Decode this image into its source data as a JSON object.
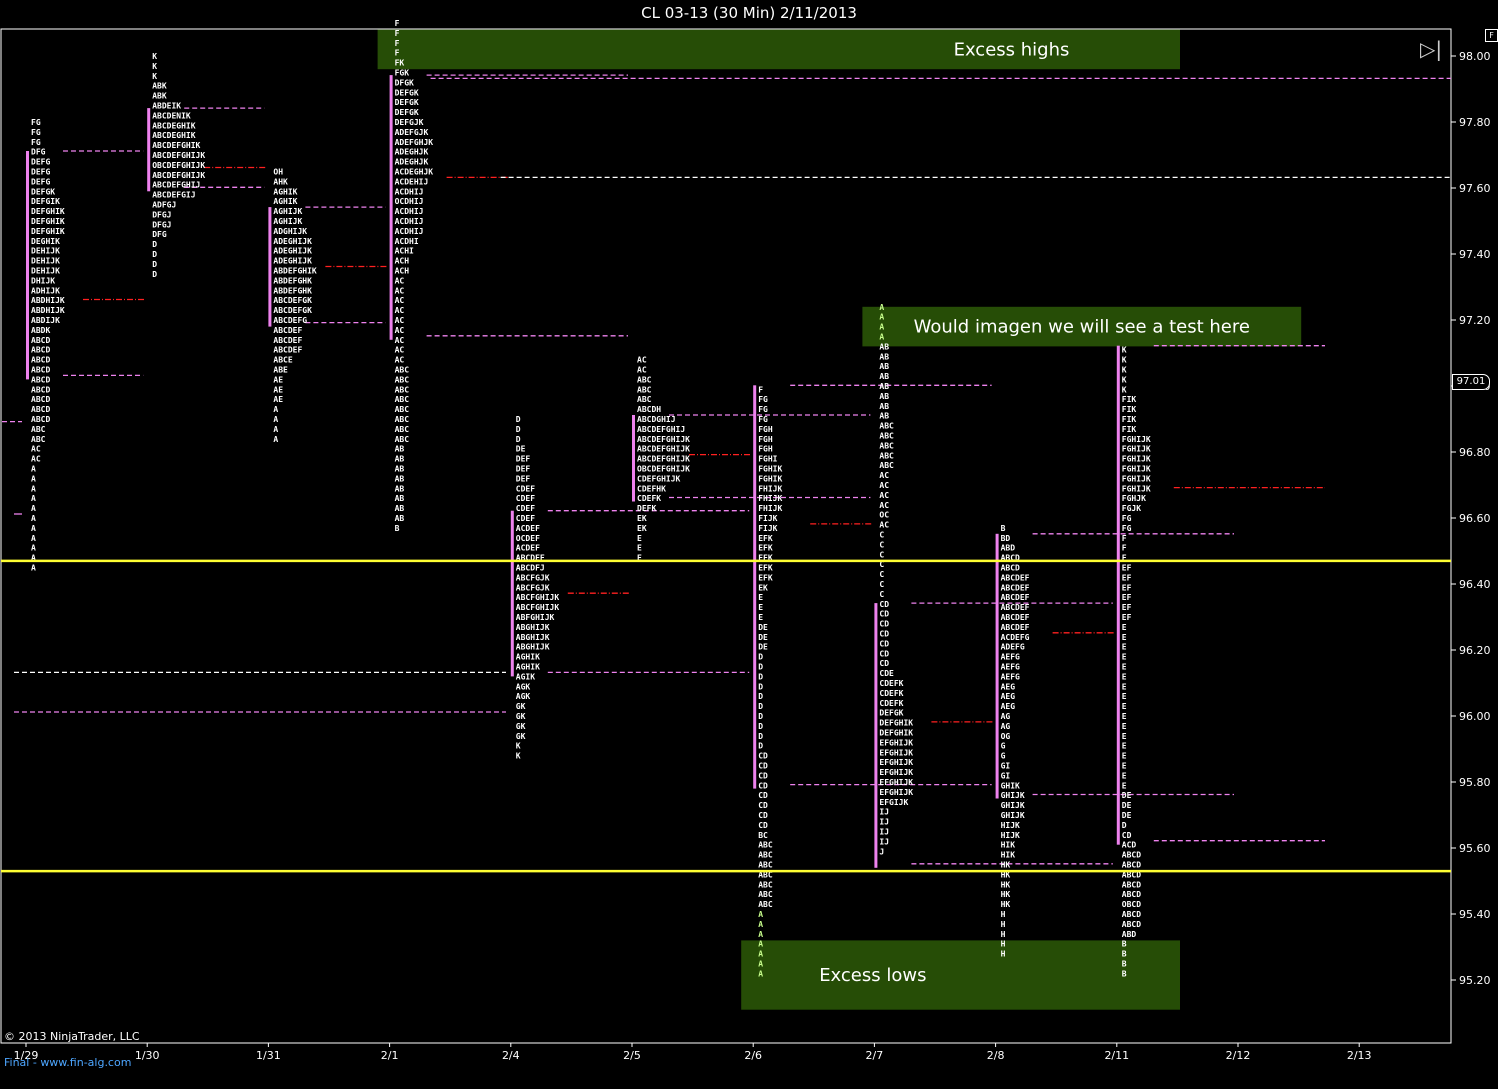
{
  "window": {
    "title": "CL 03-13 (30 Min)  2/11/2013"
  },
  "footer": {
    "copyright": "© 2013 NinjaTrader, LLC",
    "link": "Final - www.fin-alg.com"
  },
  "controls": {
    "corner_label": "F"
  },
  "current_price": "97.01",
  "chart_data": {
    "type": "market-profile",
    "title": "CL 03-13 (30 Min)  2/11/2013",
    "xlabel": "",
    "ylabel": "",
    "ylim": [
      95.0,
      98.1
    ],
    "y_ticks": [
      "98.00",
      "97.80",
      "97.60",
      "97.40",
      "97.20",
      "97.00",
      "96.80",
      "96.60",
      "96.40",
      "96.20",
      "96.00",
      "95.80",
      "95.60",
      "95.40",
      "95.20"
    ],
    "x_ticks": [
      "1/29",
      "1/30",
      "1/31",
      "2/1",
      "2/4",
      "2/5",
      "2/6",
      "2/7",
      "2/8",
      "2/11",
      "2/12",
      "2/13"
    ],
    "horizontal_lines": [
      {
        "price": 96.47,
        "color": "#ffff33"
      },
      {
        "price": 95.53,
        "color": "#ffff33"
      }
    ],
    "annotations": [
      {
        "text": "Excess highs",
        "price_top": 98.08,
        "price_bottom": 97.96,
        "from_date": "2/1",
        "to_date": "2/12"
      },
      {
        "text": "Would imagen we will see a test here",
        "price_top": 97.24,
        "price_bottom": 97.12,
        "from_date": "2/7",
        "to_date": "2/13"
      },
      {
        "text": "Excess lows",
        "price_top": 95.32,
        "price_bottom": 95.11,
        "from_date": "2/6",
        "to_date": "2/12"
      }
    ],
    "profiles": [
      {
        "date": "1/29",
        "high": 97.8,
        "rows": [
          "FG",
          "FG",
          "FG",
          "DFG",
          "DEFG",
          "DEFG",
          "DEFG",
          "DEFGK",
          "DEFGIK",
          "DEFGHIK",
          "DEFGHIK",
          "DEFGHIK",
          "DEGHIK",
          "DEHIJK",
          "DEHIJK",
          "DEHIJK",
          "DHIJK",
          "ADHIJK",
          "ABDHIJK",
          "ABDHIJK",
          "ABDIJK",
          "ABDK",
          "ABCD",
          "ABCD",
          "ABCD",
          "ABCD",
          "ABCD",
          "ABCD",
          "ABCD",
          "ABCD",
          "ABCD",
          "ABC",
          "ABC",
          "AC",
          "AC",
          "A",
          "A",
          "A",
          "A",
          "A",
          "A",
          "A",
          "A",
          "A",
          "A",
          "A"
        ],
        "value_high": 97.7,
        "value_low": 97.02,
        "poc": 97.25,
        "side_levels": [
          96.88,
          96.6,
          96.12,
          96.0
        ]
      },
      {
        "date": "1/30",
        "high": 98.0,
        "rows": [
          "K",
          "K",
          "K",
          "ABK",
          "ABK",
          "ABDEIK",
          "ABCDENIK",
          "ABCDEGHIK",
          "ABCDEGHIK",
          "ABCDEFGHIK",
          "ABCDEFGHIJK",
          "OBCDEFGHIJK",
          "ABCDEFGHIJK",
          "ABCDEFGHIJ",
          "ABCDEFGIJ",
          "ADFGJ",
          "DFGJ",
          "DFGJ",
          "DFG",
          "D",
          "D",
          "D",
          "D"
        ],
        "value_high": 97.83,
        "value_low": 97.59,
        "poc": 97.65
      },
      {
        "date": "1/31",
        "high": 97.65,
        "rows": [
          "OH",
          "AHK",
          "AGHIK",
          "AGHIK",
          "AGHIJK",
          "AGHIJK",
          "ADGHIJK",
          "ADEGHIJK",
          "ADEGHIJK",
          "ADEGHIJK",
          "ABDEFGHIK",
          "ABDEFGHK",
          "ABDEFGHK",
          "ABCDEFGK",
          "ABCDEFGK",
          "ABCDEFG",
          "ABCDEF",
          "ABCDEF",
          "ABCDEF",
          "ABCE",
          "ABE",
          "AE",
          "AE",
          "AE",
          "A",
          "A",
          "A",
          "A"
        ],
        "value_high": 97.53,
        "value_low": 97.18,
        "poc": 97.35
      },
      {
        "date": "2/1",
        "high": 98.1,
        "rows": [
          "F",
          "F",
          "F",
          "F",
          "FK",
          "FGK",
          "DFGK",
          "DEFGK",
          "DEFGK",
          "DEFGK",
          "DEFGJK",
          "ADEFGJK",
          "ADEFGHJK",
          "ADEGHJK",
          "ADEGHJK",
          "ACDEGHJK",
          "ACDEHIJ",
          "ACDHIJ",
          "OCDHIJ",
          "ACDHIJ",
          "ACDHIJ",
          "ACDHIJ",
          "ACDHI",
          "ACHI",
          "ACH",
          "ACH",
          "AC",
          "AC",
          "AC",
          "AC",
          "AC",
          "AC",
          "AC",
          "AC",
          "AC",
          "ABC",
          "ABC",
          "ABC",
          "ABC",
          "ABC",
          "ABC",
          "ABC",
          "ABC",
          "AB",
          "AB",
          "AB",
          "AB",
          "AB",
          "AB",
          "AB",
          "AB",
          "B"
        ],
        "value_high": 97.93,
        "value_low": 97.14,
        "poc": 97.62,
        "ext_levels": [
          97.92,
          97.62
        ]
      },
      {
        "date": "2/4",
        "high": 96.9,
        "rows": [
          "D",
          "D",
          "D",
          "DE",
          "DEF",
          "DEF",
          "DEF",
          "CDEF",
          "CDEF",
          "CDEF",
          "CDEF",
          "ACDEF",
          "OCDEF",
          "ACDEF",
          "ABCDEF",
          "ABCDFJ",
          "ABCFGJK",
          "ABCFGJK",
          "ABCFGHIJK",
          "ABCFGHIJK",
          "ABFGHIJK",
          "ABGHIJK",
          "ABGHIJK",
          "ABGHIJK",
          "AGHIK",
          "AGHIK",
          "AGIK",
          "AGK",
          "AGK",
          "GK",
          "GK",
          "GK",
          "GK",
          "K",
          "K"
        ],
        "value_high": 96.61,
        "value_low": 96.12,
        "poc": 96.36
      },
      {
        "date": "2/5",
        "high": 97.08,
        "rows": [
          "AC",
          "AC",
          "ABC",
          "ABC",
          "ABC",
          "ABCDH",
          "ABCDGHIJ",
          "ABCDEFGHIJ",
          "ABCDEFGHIJK",
          "ABCDEFGHIJK",
          "ABCDEFGHIJK",
          "OBCDEFGHIJK",
          "CDEFGHIJK",
          "CDEFHK",
          "CDEFK",
          "DEFK",
          "EK",
          "EK",
          "E",
          "E",
          "E"
        ],
        "value_high": 96.9,
        "value_low": 96.65,
        "poc": 96.78
      },
      {
        "date": "2/6",
        "high": 96.99,
        "rows": [
          "F",
          "FG",
          "FG",
          "FG",
          "FGH",
          "FGH",
          "FGH",
          "FGHI",
          "FGHIK",
          "FGHIK",
          "FHIJK",
          "FHIJK",
          "FHIJK",
          "FIJK",
          "FIJK",
          "EFK",
          "EFK",
          "EFK",
          "EFK",
          "EFK",
          "EK",
          "E",
          "E",
          "E",
          "DE",
          "DE",
          "DE",
          "D",
          "D",
          "D",
          "D",
          "D",
          "D",
          "D",
          "D",
          "D",
          "D",
          "CD",
          "CD",
          "CD",
          "CD",
          "CD",
          "CD",
          "CD",
          "CD",
          "BC",
          "ABC",
          "ABC",
          "ABC",
          "ABC",
          "ABC",
          "ABC",
          "ABC",
          "A",
          "A",
          "A",
          "A",
          "A",
          "A",
          "A"
        ],
        "value_high": 96.99,
        "value_low": 95.78,
        "poc": 96.57,
        "green_from": 53
      },
      {
        "date": "2/7",
        "high": 97.24,
        "rows": [
          "A",
          "A",
          "A",
          "A",
          "AB",
          "AB",
          "AB",
          "AB",
          "AB",
          "AB",
          "AB",
          "AB",
          "ABC",
          "ABC",
          "ABC",
          "ABC",
          "ABC",
          "AC",
          "AC",
          "AC",
          "AC",
          "OC",
          "AC",
          "C",
          "C",
          "C",
          "C",
          "C",
          "C",
          "C",
          "CD",
          "CD",
          "CD",
          "CD",
          "CD",
          "CD",
          "CD",
          "CDE",
          "CDEFK",
          "CDEFK",
          "CDEFK",
          "DEFGK",
          "DEFGHIK",
          "DEFGHIK",
          "EFGHIJK",
          "EFGHIJK",
          "EFGHIJK",
          "EFGHIJK",
          "EFGHIJK",
          "EFGHIJK",
          "EFGIJK",
          "IJ",
          "IJ",
          "IJ",
          "IJ",
          "J"
        ],
        "value_high": 96.33,
        "value_low": 95.54,
        "poc": 95.97,
        "green_to": 4
      },
      {
        "date": "2/8",
        "high": 96.57,
        "rows": [
          "B",
          "BD",
          "ABD",
          "ABCD",
          "ABCD",
          "ABCDEF",
          "ABCDEF",
          "ABCDEF",
          "ABCDEF",
          "ABCDEF",
          "ABCDEF",
          "ACDEFG",
          "ADEFG",
          "AEFG",
          "AEFG",
          "AEFG",
          "AEG",
          "AEG",
          "AEG",
          "AG",
          "AG",
          "OG",
          "G",
          "G",
          "GI",
          "GI",
          "GHIK",
          "GHIJK",
          "GHIJK",
          "GHIJK",
          "HIJK",
          "HIJK",
          "HIK",
          "HIK",
          "HK",
          "HK",
          "HK",
          "HK",
          "HK",
          "H",
          "H",
          "H",
          "H",
          "H"
        ],
        "value_high": 96.54,
        "value_low": 95.75,
        "poc": 96.24
      },
      {
        "date": "2/11",
        "high": 97.11,
        "rows": [
          "K",
          "K",
          "K",
          "K",
          "K",
          "FIK",
          "FIK",
          "FIK",
          "FIK",
          "FGHIJK",
          "FGHIJK",
          "FGHIJK",
          "FGHIJK",
          "FGHIJK",
          "FGHIJK",
          "FGHJK",
          "FGJK",
          "FG",
          "FG",
          "F",
          "F",
          "F",
          "EF",
          "EF",
          "EF",
          "EF",
          "EF",
          "EF",
          "E",
          "E",
          "E",
          "E",
          "E",
          "E",
          "E",
          "E",
          "E",
          "E",
          "E",
          "E",
          "E",
          "E",
          "E",
          "E",
          "E",
          "DE",
          "DE",
          "DE",
          "D",
          "CD",
          "ACD",
          "ABCD",
          "ABCD",
          "ABCD",
          "ABCD",
          "ABCD",
          "OBCD",
          "ABCD",
          "ABCD",
          "ABD",
          "B",
          "B",
          "B",
          "B"
        ],
        "value_high": 97.11,
        "value_low": 95.61,
        "poc": 96.68
      }
    ]
  }
}
